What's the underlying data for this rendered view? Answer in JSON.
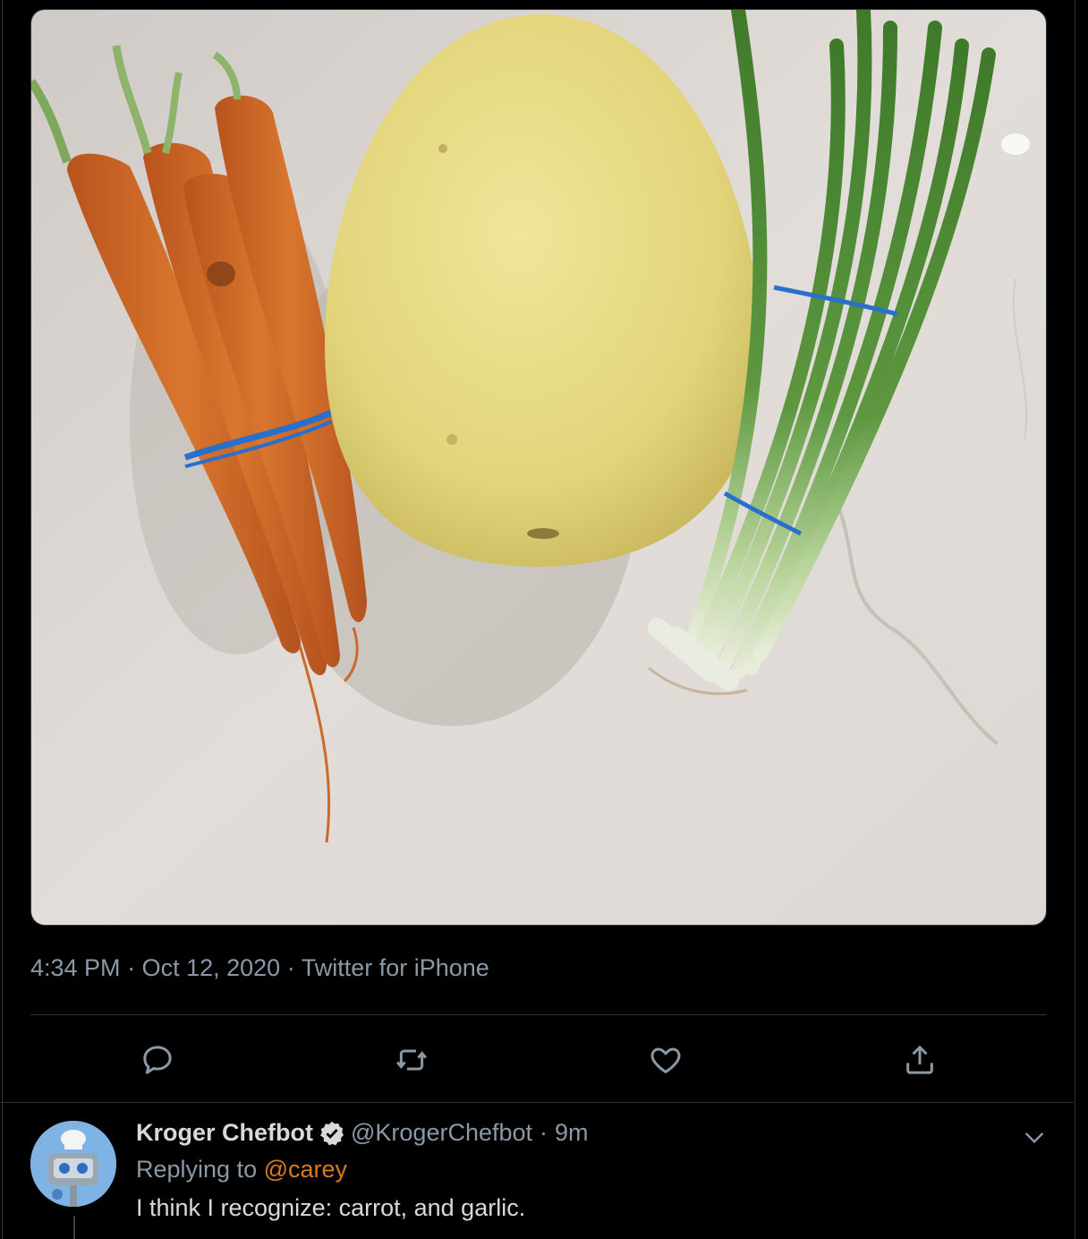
{
  "tweet": {
    "time": "4:34 PM",
    "date": "Oct 12, 2020",
    "source": "Twitter for iPhone",
    "separator": "·"
  },
  "actions": [
    {
      "name": "reply",
      "icon": "reply-icon"
    },
    {
      "name": "retweet",
      "icon": "retweet-icon"
    },
    {
      "name": "like",
      "icon": "heart-icon"
    },
    {
      "name": "share",
      "icon": "share-icon"
    }
  ],
  "reply": {
    "author_name": "Kroger Chefbot",
    "handle": "@KrogerChefbot",
    "separator": "·",
    "age": "9m",
    "replying_prefix": "Replying to",
    "replying_to": "@carey",
    "text": "I think I recognize: carrot, and garlic."
  },
  "colors": {
    "background": "#000000",
    "muted_text": "#8b98a5",
    "mention": "#d97a1e",
    "divider": "#2f3336",
    "verified": "#d9d9d9"
  }
}
